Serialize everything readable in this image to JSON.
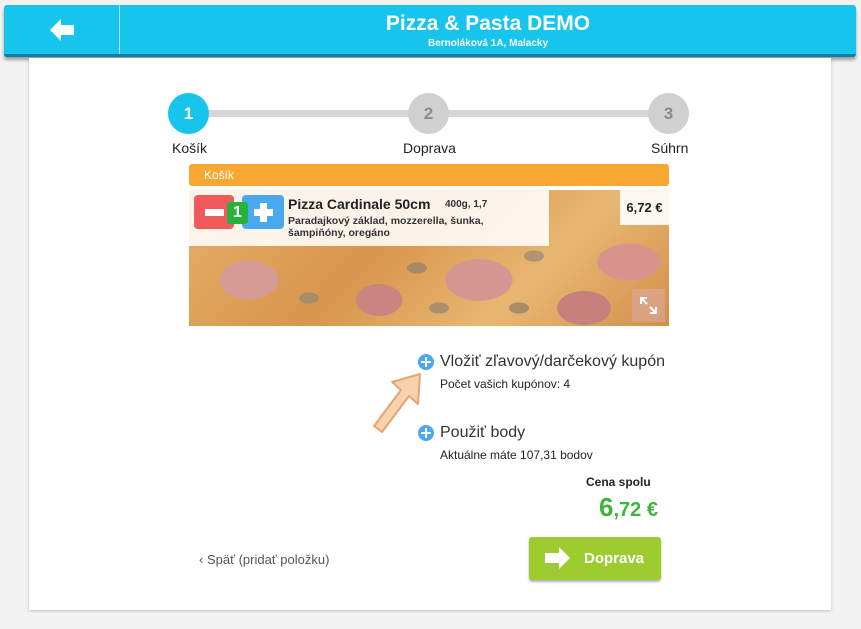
{
  "header": {
    "title": "Pizza & Pasta DEMO",
    "subtitle": "Bernoláková 1A, Malacky",
    "back_icon": "arrow-left-icon"
  },
  "steps": [
    {
      "number": "1",
      "label": "Košík",
      "active": true
    },
    {
      "number": "2",
      "label": "Doprava",
      "active": false
    },
    {
      "number": "3",
      "label": "Súhrn",
      "active": false
    }
  ],
  "cart": {
    "heading": "Košík",
    "item": {
      "quantity": "1",
      "name": "Pizza Cardinale 50cm",
      "meta": "400g, 1,7",
      "description": "Paradajkový základ, mozzerella, šunka, šampiňóny, oregáno",
      "price": "6,72 €",
      "expand_icon": "expand-icon"
    }
  },
  "coupon": {
    "label": "Vložiť zľavový/darčekový kupón",
    "info": "Počet vašich kupónov: 4"
  },
  "points": {
    "label": "Použiť body",
    "info": "Aktuálne máte 107,31 bodov"
  },
  "total": {
    "label": "Cena spolu",
    "integer": "6",
    "decimal": ",72 €"
  },
  "actions": {
    "back_label": "Späť (pridať položku)",
    "next_label": "Doprava"
  },
  "colors": {
    "header": "#17c4ec",
    "cart_heading": "#f7a832",
    "total": "#3db53d",
    "next_button": "#9ccc30"
  }
}
